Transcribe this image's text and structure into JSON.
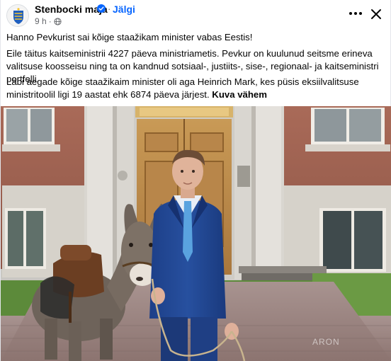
{
  "header": {
    "page_name": "Stenbocki maja",
    "follow_label": "Jälgi",
    "time": "9 h",
    "dot": "·"
  },
  "post": {
    "line1": "Hanno Pevkurist sai kõige staažikam minister vabas Eestis!",
    "line2": "Eile täitus kaitseministrii 4227 päeva ministriametis. Pevkur on kuulunud seitsme erineva valitsuse koosseisu ning ta on kandnud sotsiaal-, justiits-, sise-, regionaal- ja kaitseministri portfelli.",
    "line3": "Läbi aegade kõige staažikaim minister oli aga Heinrich Mark, kes püsis eksiilvalitsuse ministritoolil ligi 19 aastat ehk 6874 päeva järjest.",
    "see_more": "Kuva vähem"
  },
  "image": {
    "watermark": "ARON"
  },
  "colors": {
    "accent": "#0866ff",
    "secondary_text": "#65676b",
    "primary_text": "#050505"
  },
  "icons": {
    "verified": "verified-badge-icon",
    "globe": "globe-icon",
    "more": "more-options-icon",
    "close": "close-icon"
  }
}
